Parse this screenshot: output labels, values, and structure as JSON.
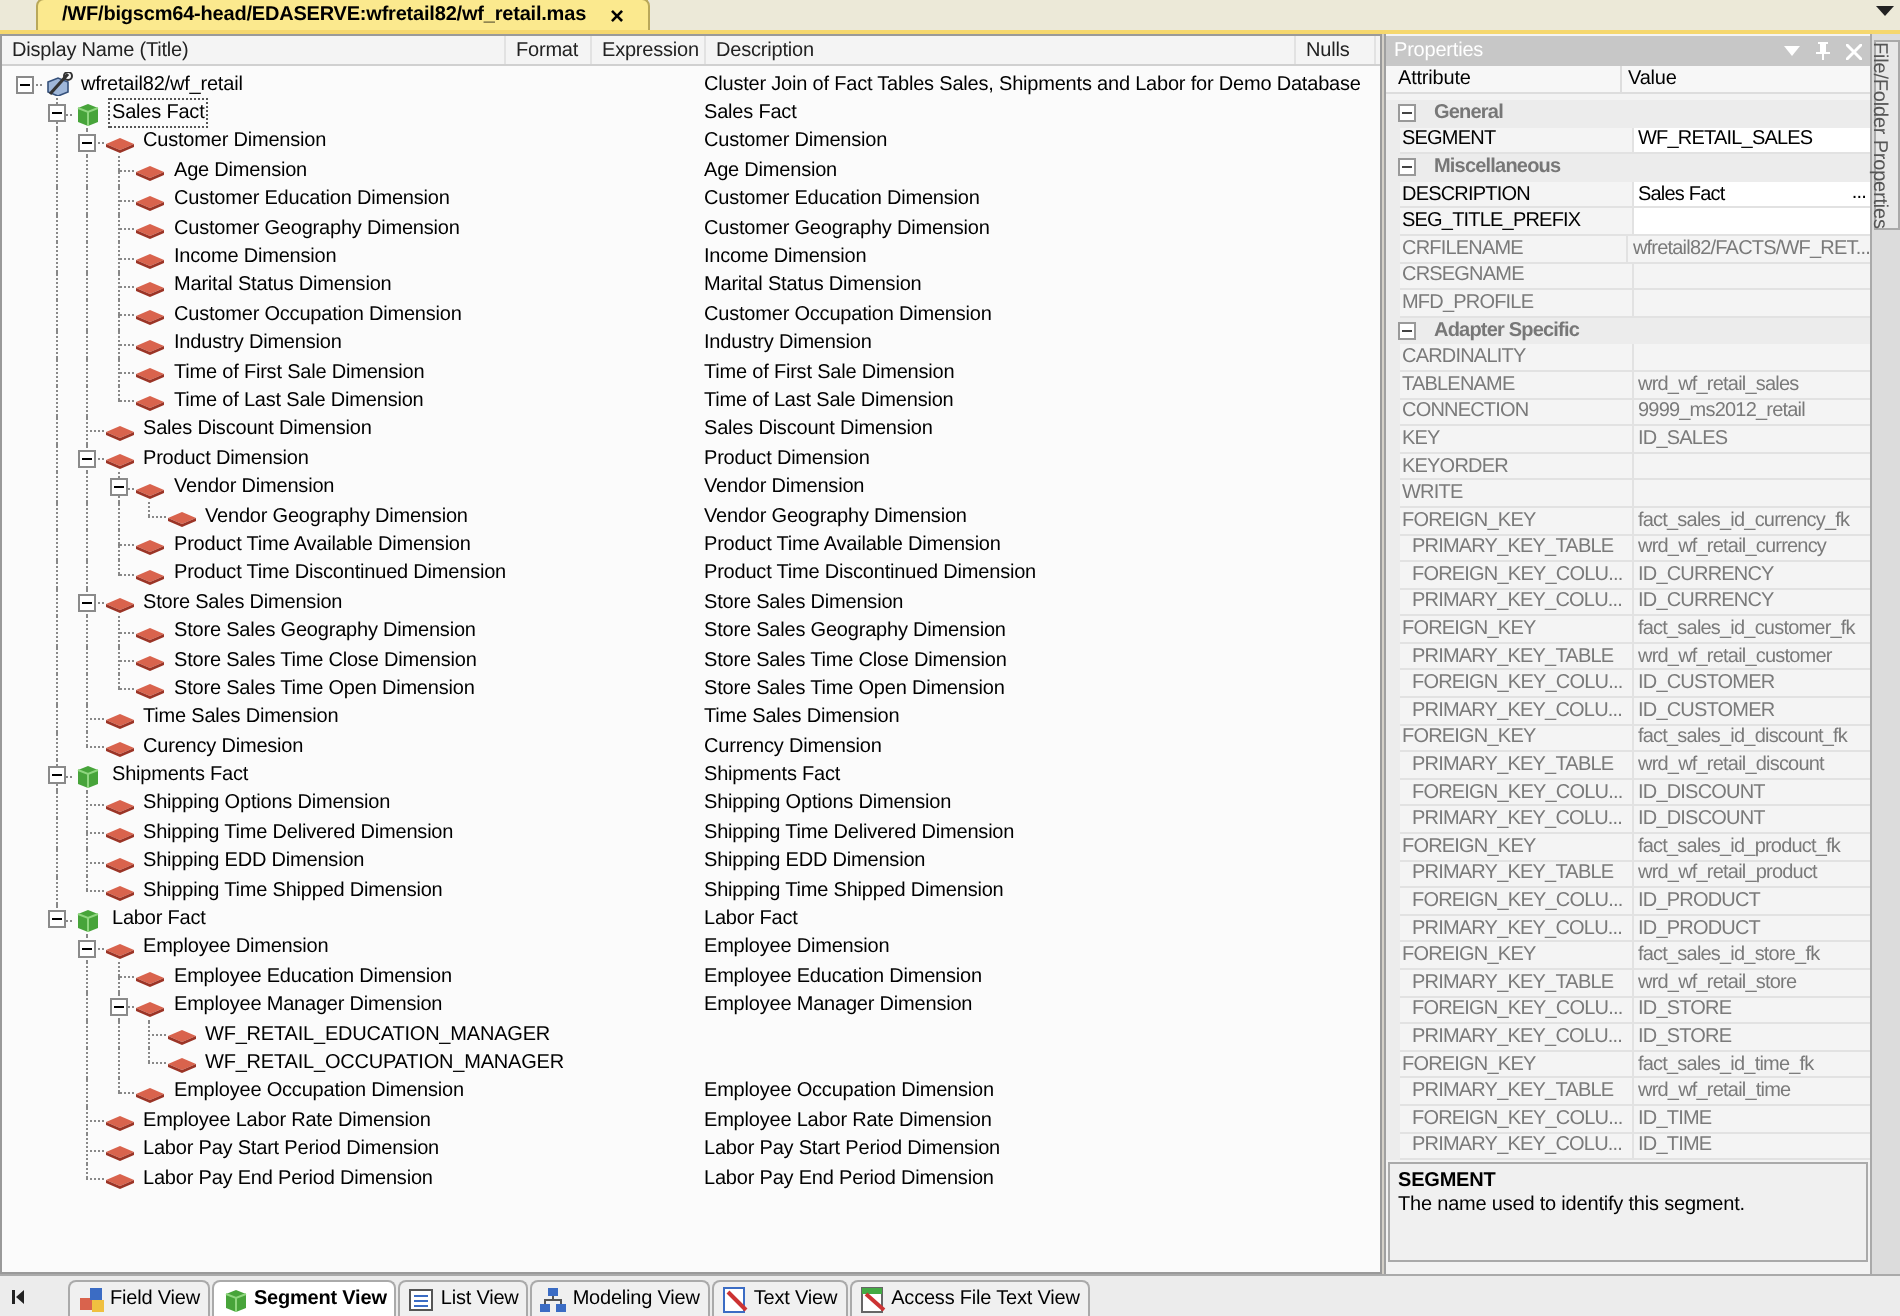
{
  "document_tab": {
    "title": "/WF/bigscm64-head/EDASERVE:wfretail82/wf_retail.mas",
    "close": "×"
  },
  "tree": {
    "columns": [
      "Display Name (Title)",
      "Format",
      "Expression",
      "Description",
      "Nulls"
    ],
    "nodes": [
      {
        "kind": "cluster",
        "name": "wfretail82/wf_retail",
        "description": "Cluster Join of Fact Tables Sales, Shipments and Labor for Demo Database",
        "selected": false,
        "expanded": true,
        "children": [
          {
            "kind": "fact",
            "name": "Sales Fact",
            "description": "Sales Fact",
            "selected": true,
            "expanded": true,
            "children": [
              {
                "kind": "dimension",
                "name": "Customer Dimension",
                "description": "Customer Dimension",
                "selected": false,
                "expanded": true,
                "children": [
                  {
                    "kind": "dimension",
                    "name": "Age Dimension",
                    "description": "Age Dimension",
                    "selected": false
                  },
                  {
                    "kind": "dimension",
                    "name": "Customer Education Dimension",
                    "description": "Customer Education Dimension",
                    "selected": false
                  },
                  {
                    "kind": "dimension",
                    "name": "Customer Geography Dimension",
                    "description": "Customer Geography Dimension",
                    "selected": false
                  },
                  {
                    "kind": "dimension",
                    "name": "Income Dimension",
                    "description": "Income Dimension",
                    "selected": false
                  },
                  {
                    "kind": "dimension",
                    "name": "Marital Status Dimension",
                    "description": "Marital Status Dimension",
                    "selected": false
                  },
                  {
                    "kind": "dimension",
                    "name": "Customer Occupation Dimension",
                    "description": "Customer Occupation Dimension",
                    "selected": false
                  },
                  {
                    "kind": "dimension",
                    "name": "Industry Dimension",
                    "description": "Industry Dimension",
                    "selected": false
                  },
                  {
                    "kind": "dimension",
                    "name": "Time of First Sale Dimension",
                    "description": "Time of First Sale Dimension",
                    "selected": false
                  },
                  {
                    "kind": "dimension",
                    "name": "Time of Last Sale Dimension",
                    "description": "Time of Last Sale Dimension",
                    "selected": false
                  }
                ]
              },
              {
                "kind": "dimension",
                "name": "Sales Discount Dimension",
                "description": "Sales Discount Dimension",
                "selected": false
              },
              {
                "kind": "dimension",
                "name": "Product Dimension",
                "description": "Product Dimension",
                "selected": false,
                "expanded": true,
                "children": [
                  {
                    "kind": "dimension",
                    "name": "Vendor Dimension",
                    "description": "Vendor Dimension",
                    "selected": false,
                    "expanded": true,
                    "children": [
                      {
                        "kind": "dimension",
                        "name": "Vendor Geography Dimension",
                        "description": "Vendor Geography Dimension",
                        "selected": false
                      }
                    ]
                  },
                  {
                    "kind": "dimension",
                    "name": "Product Time Available Dimension",
                    "description": "Product Time Available Dimension",
                    "selected": false
                  },
                  {
                    "kind": "dimension",
                    "name": "Product Time Discontinued Dimension",
                    "description": "Product Time Discontinued Dimension",
                    "selected": false
                  }
                ]
              },
              {
                "kind": "dimension",
                "name": "Store Sales Dimension",
                "description": "Store Sales Dimension",
                "selected": false,
                "expanded": true,
                "children": [
                  {
                    "kind": "dimension",
                    "name": "Store Sales Geography Dimension",
                    "description": "Store Sales Geography Dimension",
                    "selected": false
                  },
                  {
                    "kind": "dimension",
                    "name": "Store Sales Time Close Dimension",
                    "description": "Store Sales Time Close Dimension",
                    "selected": false
                  },
                  {
                    "kind": "dimension",
                    "name": "Store Sales Time Open Dimension",
                    "description": "Store Sales Time Open Dimension",
                    "selected": false
                  }
                ]
              },
              {
                "kind": "dimension",
                "name": "Time Sales Dimension",
                "description": "Time Sales Dimension",
                "selected": false
              },
              {
                "kind": "dimension",
                "name": "Curency Dimesion",
                "description": "Currency Dimension",
                "selected": false
              }
            ]
          },
          {
            "kind": "fact",
            "name": "Shipments Fact",
            "description": "Shipments Fact",
            "selected": false,
            "expanded": true,
            "children": [
              {
                "kind": "dimension",
                "name": "Shipping Options Dimension",
                "description": "Shipping Options Dimension",
                "selected": false
              },
              {
                "kind": "dimension",
                "name": "Shipping Time Delivered Dimension",
                "description": "Shipping Time Delivered Dimension",
                "selected": false
              },
              {
                "kind": "dimension",
                "name": "Shipping EDD Dimension",
                "description": "Shipping EDD Dimension",
                "selected": false
              },
              {
                "kind": "dimension",
                "name": "Shipping Time Shipped Dimension",
                "description": "Shipping Time Shipped Dimension",
                "selected": false
              }
            ]
          },
          {
            "kind": "fact",
            "name": "Labor Fact",
            "description": "Labor Fact",
            "selected": false,
            "expanded": true,
            "children": [
              {
                "kind": "dimension",
                "name": "Employee Dimension",
                "description": "Employee Dimension",
                "selected": false,
                "expanded": true,
                "children": [
                  {
                    "kind": "dimension",
                    "name": "Employee Education Dimension",
                    "description": "Employee Education Dimension",
                    "selected": false
                  },
                  {
                    "kind": "dimension",
                    "name": "Employee Manager Dimension",
                    "description": "Employee Manager Dimension",
                    "selected": false,
                    "expanded": true,
                    "children": [
                      {
                        "kind": "dimension",
                        "name": "WF_RETAIL_EDUCATION_MANAGER",
                        "selected": false
                      },
                      {
                        "kind": "dimension",
                        "name": "WF_RETAIL_OCCUPATION_MANAGER",
                        "selected": false
                      }
                    ]
                  },
                  {
                    "kind": "dimension",
                    "name": "Employee Occupation Dimension",
                    "description": "Employee Occupation Dimension",
                    "selected": false
                  }
                ]
              },
              {
                "kind": "dimension",
                "name": "Employee Labor Rate Dimension",
                "description": "Employee Labor Rate Dimension",
                "selected": false
              },
              {
                "kind": "dimension",
                "name": "Labor Pay Start Period Dimension",
                "description": "Labor Pay Start Period Dimension",
                "selected": false
              },
              {
                "kind": "dimension",
                "name": "Labor Pay End Period Dimension",
                "description": "Labor Pay End Period Dimension",
                "selected": false
              }
            ]
          }
        ]
      }
    ]
  },
  "properties": {
    "title": "Properties",
    "columns": [
      "Attribute",
      "Value"
    ],
    "rows": [
      {
        "kind": "category",
        "label": "General",
        "expanded": true
      },
      {
        "kind": "property",
        "attribute": "SEGMENT",
        "value": "WF_RETAIL_SALES",
        "editable": true
      },
      {
        "kind": "category",
        "label": "Miscellaneous",
        "expanded": true
      },
      {
        "kind": "property",
        "attribute": "DESCRIPTION",
        "value": "Sales Fact",
        "editable": true,
        "button": "..."
      },
      {
        "kind": "property",
        "attribute": "SEG_TITLE_PREFIX",
        "editable": true
      },
      {
        "kind": "property",
        "attribute": "CRFILENAME",
        "value": "wfretail82/FACTS/WF_RET...",
        "editable": false
      },
      {
        "kind": "property",
        "attribute": "CRSEGNAME",
        "editable": false
      },
      {
        "kind": "property",
        "attribute": "MFD_PROFILE",
        "editable": false
      },
      {
        "kind": "category",
        "label": "Adapter Specific",
        "expanded": true
      },
      {
        "kind": "property",
        "attribute": "CARDINALITY",
        "editable": false
      },
      {
        "kind": "property",
        "attribute": "TABLENAME",
        "value": "wrd_wf_retail_sales",
        "editable": false
      },
      {
        "kind": "property",
        "attribute": "CONNECTION",
        "value": "9999_ms2012_retail",
        "editable": false
      },
      {
        "kind": "property",
        "attribute": "KEY",
        "value": "ID_SALES",
        "editable": false
      },
      {
        "kind": "property",
        "attribute": "KEYORDER",
        "editable": false
      },
      {
        "kind": "property",
        "attribute": "WRITE",
        "editable": false
      },
      {
        "kind": "property",
        "attribute": "FOREIGN_KEY",
        "value": "fact_sales_id_currency_fk",
        "editable": false,
        "children": [
          {
            "kind": "property",
            "attribute": "PRIMARY_KEY_TABLE",
            "value": "wrd_wf_retail_currency",
            "editable": false
          },
          {
            "kind": "property",
            "attribute": "FOREIGN_KEY_COLU...",
            "value": "ID_CURRENCY",
            "editable": false
          },
          {
            "kind": "property",
            "attribute": "PRIMARY_KEY_COLU...",
            "value": "ID_CURRENCY",
            "editable": false
          }
        ]
      },
      {
        "kind": "property",
        "attribute": "FOREIGN_KEY",
        "value": "fact_sales_id_customer_fk",
        "editable": false,
        "children": [
          {
            "kind": "property",
            "attribute": "PRIMARY_KEY_TABLE",
            "value": "wrd_wf_retail_customer",
            "editable": false
          },
          {
            "kind": "property",
            "attribute": "FOREIGN_KEY_COLU...",
            "value": "ID_CUSTOMER",
            "editable": false
          },
          {
            "kind": "property",
            "attribute": "PRIMARY_KEY_COLU...",
            "value": "ID_CUSTOMER",
            "editable": false
          }
        ]
      },
      {
        "kind": "property",
        "attribute": "FOREIGN_KEY",
        "value": "fact_sales_id_discount_fk",
        "editable": false,
        "children": [
          {
            "kind": "property",
            "attribute": "PRIMARY_KEY_TABLE",
            "value": "wrd_wf_retail_discount",
            "editable": false
          },
          {
            "kind": "property",
            "attribute": "FOREIGN_KEY_COLU...",
            "value": "ID_DISCOUNT",
            "editable": false
          },
          {
            "kind": "property",
            "attribute": "PRIMARY_KEY_COLU...",
            "value": "ID_DISCOUNT",
            "editable": false
          }
        ]
      },
      {
        "kind": "property",
        "attribute": "FOREIGN_KEY",
        "value": "fact_sales_id_product_fk",
        "editable": false,
        "children": [
          {
            "kind": "property",
            "attribute": "PRIMARY_KEY_TABLE",
            "value": "wrd_wf_retail_product",
            "editable": false
          },
          {
            "kind": "property",
            "attribute": "FOREIGN_KEY_COLU...",
            "value": "ID_PRODUCT",
            "editable": false
          },
          {
            "kind": "property",
            "attribute": "PRIMARY_KEY_COLU...",
            "value": "ID_PRODUCT",
            "editable": false
          }
        ]
      },
      {
        "kind": "property",
        "attribute": "FOREIGN_KEY",
        "value": "fact_sales_id_store_fk",
        "editable": false,
        "children": [
          {
            "kind": "property",
            "attribute": "PRIMARY_KEY_TABLE",
            "value": "wrd_wf_retail_store",
            "editable": false
          },
          {
            "kind": "property",
            "attribute": "FOREIGN_KEY_COLU...",
            "value": "ID_STORE",
            "editable": false
          },
          {
            "kind": "property",
            "attribute": "PRIMARY_KEY_COLU...",
            "value": "ID_STORE",
            "editable": false
          }
        ]
      },
      {
        "kind": "property",
        "attribute": "FOREIGN_KEY",
        "value": "fact_sales_id_time_fk",
        "editable": false,
        "children": [
          {
            "kind": "property",
            "attribute": "PRIMARY_KEY_TABLE",
            "value": "wrd_wf_retail_time",
            "editable": false
          },
          {
            "kind": "property",
            "attribute": "FOREIGN_KEY_COLU...",
            "value": "ID_TIME",
            "editable": false
          },
          {
            "kind": "property",
            "attribute": "PRIMARY_KEY_COLU...",
            "value": "ID_TIME",
            "editable": false
          }
        ]
      }
    ],
    "help": {
      "title": "SEGMENT",
      "text": "The name used to identify this segment."
    }
  },
  "side_tab": {
    "label": "File/Folder Properties"
  },
  "view_tabs": [
    {
      "label": "Field View",
      "selected": false
    },
    {
      "label": "Segment View",
      "selected": true
    },
    {
      "label": "List View",
      "selected": false
    },
    {
      "label": "Modeling View",
      "selected": false
    },
    {
      "label": "Text View",
      "selected": false
    },
    {
      "label": "Access File Text View",
      "selected": false
    }
  ]
}
